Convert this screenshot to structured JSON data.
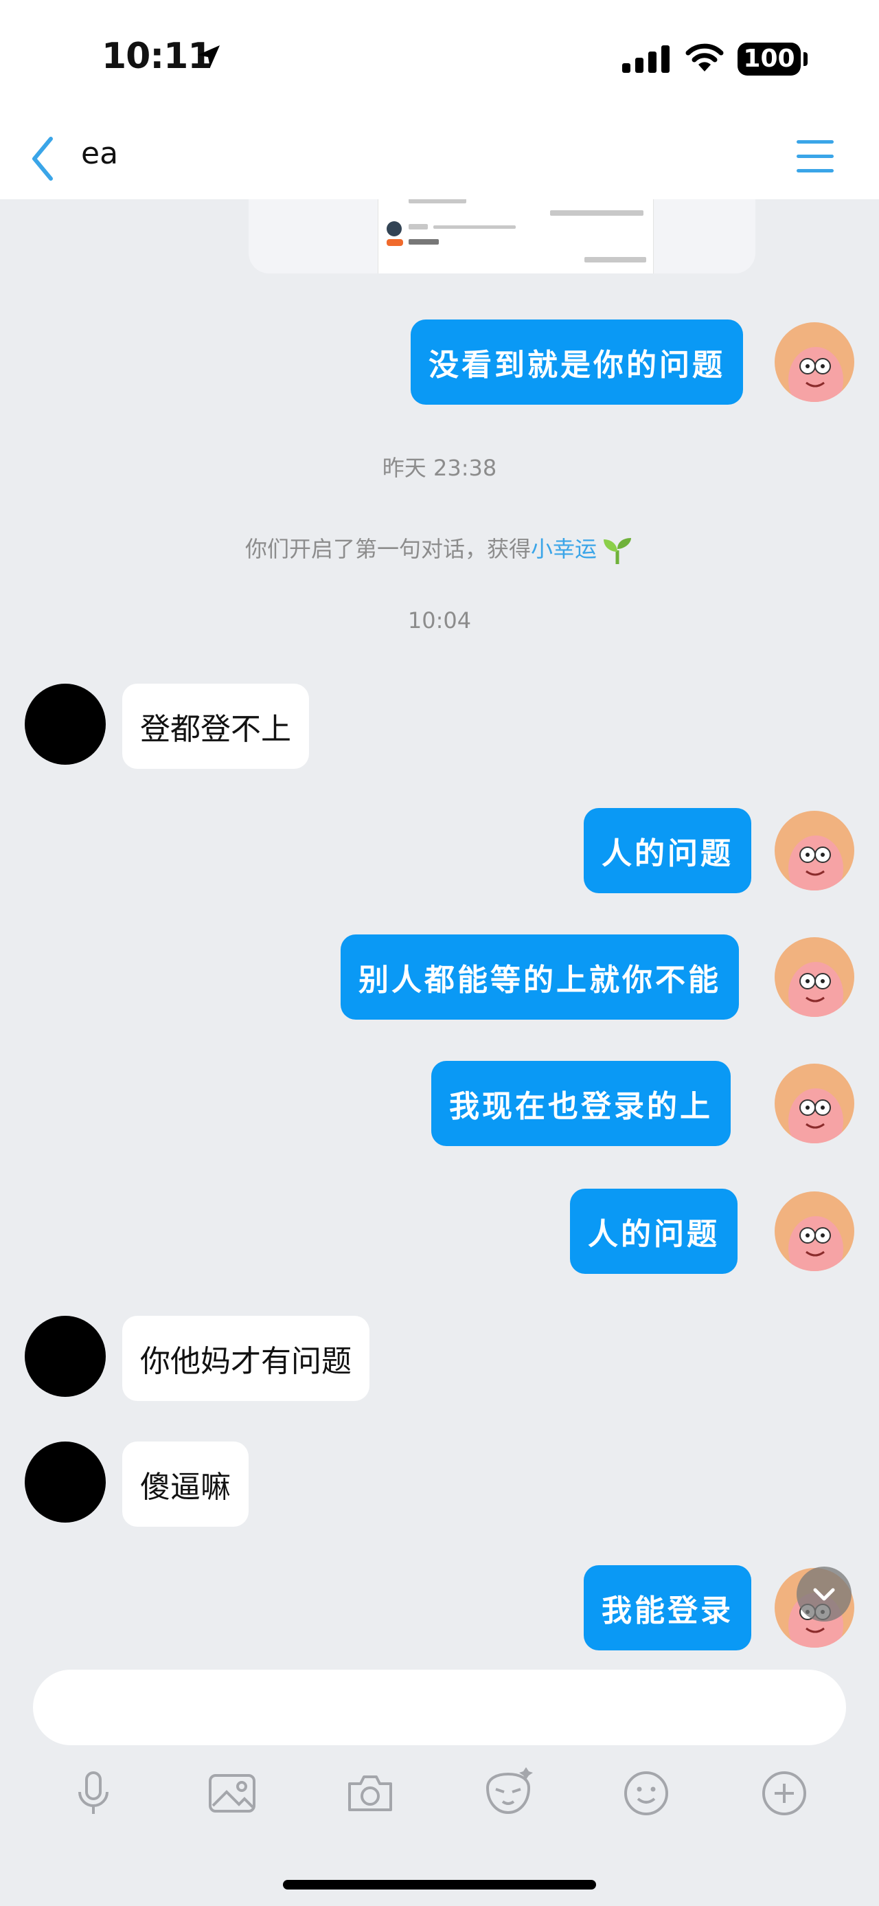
{
  "status": {
    "time": "10:11",
    "battery": "100"
  },
  "header": {
    "title": "ea"
  },
  "chat": {
    "timestamps": {
      "yesterday": "昨天 23:38",
      "today": "10:04"
    },
    "system_message": {
      "text": "你们开启了第一句对话，获得",
      "highlight": "小幸运"
    },
    "messages": [
      {
        "direction": "out",
        "text": "没看到就是你的问题"
      },
      {
        "direction": "in",
        "text": "登都登不上"
      },
      {
        "direction": "out",
        "text": "人的问题"
      },
      {
        "direction": "out",
        "text": "别人都能等的上就你不能"
      },
      {
        "direction": "out",
        "text": "我现在也登录的上"
      },
      {
        "direction": "out",
        "text": "人的问题"
      },
      {
        "direction": "in",
        "text": "你他妈才有问题"
      },
      {
        "direction": "in",
        "text": "傻逼嘛"
      },
      {
        "direction": "out",
        "text": "我能登录"
      }
    ]
  },
  "input": {
    "placeholder": ""
  },
  "toolbar": [
    "mic-icon",
    "image-icon",
    "camera-icon",
    "sticker-icon",
    "emoji-icon",
    "plus-icon"
  ],
  "colors": {
    "accent": "#0a99f5",
    "link": "#3aa5e8",
    "background": "#ebedf0"
  }
}
